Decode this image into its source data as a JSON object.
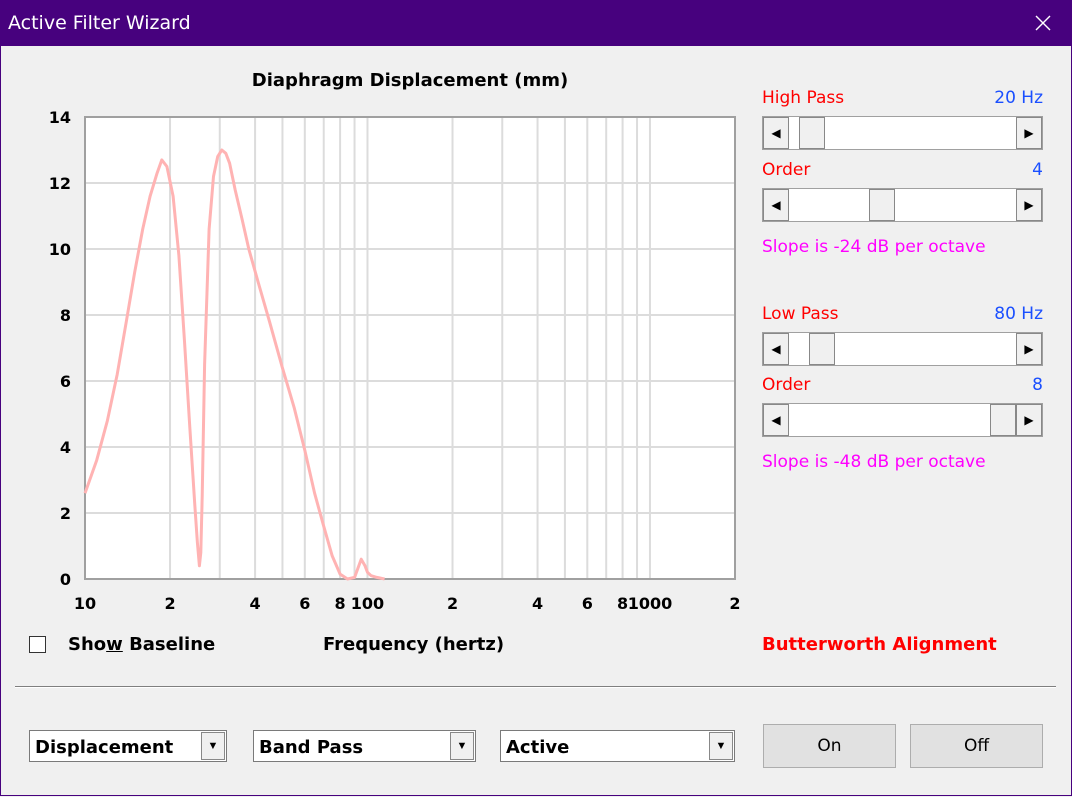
{
  "window": {
    "title": "Active Filter Wizard"
  },
  "chart_data": {
    "type": "line",
    "title": "Diaphragm Displacement (mm)",
    "xlabel": "Frequency (hertz)",
    "ylabel": "",
    "xscale": "log",
    "xlim": [
      10,
      2000
    ],
    "ylim": [
      0,
      14
    ],
    "grid": true,
    "yticks": [
      0,
      2,
      4,
      6,
      8,
      10,
      12,
      14
    ],
    "xtick_labels": [
      {
        "value": 10,
        "label": "10"
      },
      {
        "value": 20,
        "label": "2"
      },
      {
        "value": 40,
        "label": "4"
      },
      {
        "value": 60,
        "label": "6"
      },
      {
        "value": 80,
        "label": "8"
      },
      {
        "value": 100,
        "label": "100"
      },
      {
        "value": 200,
        "label": "2"
      },
      {
        "value": 400,
        "label": "4"
      },
      {
        "value": 600,
        "label": "6"
      },
      {
        "value": 800,
        "label": "8"
      },
      {
        "value": 1000,
        "label": "1000"
      },
      {
        "value": 2000,
        "label": "2"
      }
    ],
    "series": [
      {
        "color": "#ffb3b3",
        "x": [
          10,
          11,
          12,
          13,
          14,
          15,
          16,
          17,
          18,
          18.7,
          19.5,
          20.5,
          21.5,
          22.5,
          23.5,
          24.5,
          25,
          25.4,
          25.7,
          26,
          26.5,
          27.5,
          28.5,
          29.5,
          30.5,
          31.5,
          32.5,
          34,
          36,
          38,
          41,
          45,
          50,
          55,
          60,
          65,
          70,
          75,
          80,
          85,
          90,
          95,
          98,
          100,
          103,
          108,
          115
        ],
        "y": [
          2.6,
          3.6,
          4.8,
          6.2,
          7.8,
          9.3,
          10.6,
          11.6,
          12.3,
          12.7,
          12.5,
          11.6,
          9.8,
          7.2,
          4.6,
          2.2,
          1.1,
          0.4,
          0.8,
          2.5,
          6.5,
          10.6,
          12.2,
          12.8,
          13.0,
          12.9,
          12.6,
          11.8,
          10.9,
          10.0,
          9.0,
          7.8,
          6.4,
          5.2,
          3.9,
          2.6,
          1.6,
          0.7,
          0.15,
          0.0,
          0.05,
          0.6,
          0.4,
          0.2,
          0.1,
          0.05,
          0.0
        ]
      }
    ]
  },
  "controls": {
    "high_pass": {
      "label": "High Pass",
      "value": "20 Hz",
      "position": 0.05
    },
    "high_order": {
      "label": "Order",
      "value": "4",
      "position": 0.4
    },
    "high_slope": "Slope is -24 dB per octave",
    "low_pass": {
      "label": "Low Pass",
      "value": "80 Hz",
      "position": 0.1
    },
    "low_order": {
      "label": "Order",
      "value": "8",
      "position": 1.0
    },
    "low_slope": "Slope is -48 dB per octave",
    "alignment": "Butterworth Alignment"
  },
  "baseline": {
    "label_prefix": "Sho",
    "label_accel": "w",
    "label_suffix": " Baseline",
    "checked": false
  },
  "bottom": {
    "combo1": "Displacement",
    "combo2": "Band Pass",
    "combo3": "Active",
    "on_label": "On",
    "off_label": "Off"
  }
}
